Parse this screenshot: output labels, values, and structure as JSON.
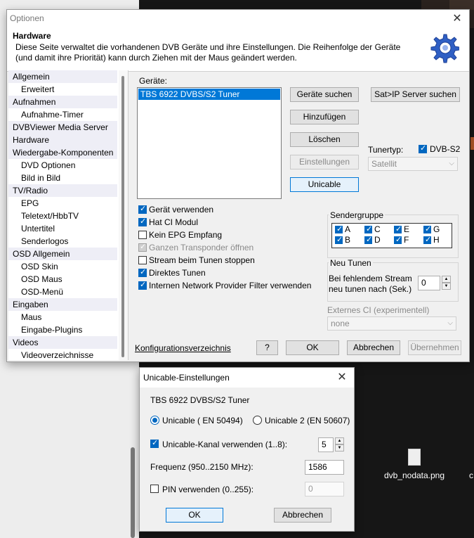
{
  "main_dialog": {
    "title": "Optionen",
    "header_title": "Hardware",
    "header_desc": "Diese Seite verwaltet die vorhandenen DVB Geräte und ihre Einstellungen. Die Reihenfolge der Geräte (und damit ihre Priorität) kann durch Ziehen mit der Maus geändert werden.",
    "gear_icon": "gear-icon"
  },
  "tree": {
    "items": [
      {
        "label": "Allgemein",
        "cat": true
      },
      {
        "label": "Erweitert",
        "cat": false
      },
      {
        "label": "Aufnahmen",
        "cat": true
      },
      {
        "label": "Aufnahme-Timer",
        "cat": false
      },
      {
        "label": "DVBViewer Media Server",
        "cat": true
      },
      {
        "label": "Hardware",
        "cat": true
      },
      {
        "label": "Wiedergabe-Komponenten",
        "cat": true
      },
      {
        "label": "DVD Optionen",
        "cat": false
      },
      {
        "label": "Bild in Bild",
        "cat": false
      },
      {
        "label": "TV/Radio",
        "cat": true
      },
      {
        "label": "EPG",
        "cat": false
      },
      {
        "label": "Teletext/HbbTV",
        "cat": false
      },
      {
        "label": "Untertitel",
        "cat": false
      },
      {
        "label": "Senderlogos",
        "cat": false
      },
      {
        "label": "OSD Allgemein",
        "cat": true
      },
      {
        "label": "OSD Skin",
        "cat": false
      },
      {
        "label": "OSD Maus",
        "cat": false
      },
      {
        "label": "OSD-Menü",
        "cat": false
      },
      {
        "label": "Eingaben",
        "cat": true
      },
      {
        "label": "Maus",
        "cat": false
      },
      {
        "label": "Eingabe-Plugins",
        "cat": false
      },
      {
        "label": "Videos",
        "cat": true
      },
      {
        "label": "Videoverzeichnisse",
        "cat": false
      }
    ]
  },
  "devices": {
    "label": "Geräte:",
    "list": [
      "TBS 6922 DVBS/S2 Tuner"
    ],
    "btn_search": "Geräte suchen",
    "btn_satip": "Sat>IP Server suchen",
    "btn_add": "Hinzufügen",
    "btn_delete": "Löschen",
    "btn_settings": "Einstellungen",
    "btn_unicable": "Unicable",
    "tunertype_label": "Tunertyp:",
    "dvbs2_label": "DVB-S2",
    "tunertype_value": "Satellit"
  },
  "options": [
    {
      "label": "Gerät verwenden",
      "state": "on"
    },
    {
      "label": "Hat CI Modul",
      "state": "on"
    },
    {
      "label": "Kein EPG Empfang",
      "state": "off"
    },
    {
      "label": "Ganzen Transponder öffnen",
      "state": "dis"
    },
    {
      "label": "Stream beim Tunen stoppen",
      "state": "off"
    },
    {
      "label": "Direktes Tunen",
      "state": "on"
    },
    {
      "label": "Internen Network Provider Filter verwenden",
      "state": "on"
    }
  ],
  "sendergruppe": {
    "title": "Sendergruppe",
    "groups": [
      "A",
      "C",
      "E",
      "G",
      "B",
      "D",
      "F",
      "H"
    ]
  },
  "neu_tunen": {
    "title": "Neu Tunen",
    "text1": "Bei fehlendem Stream",
    "text2": "neu tunen nach (Sek.)",
    "value": "0"
  },
  "externes_ci": {
    "title": "Externes CI (experimentell)",
    "value": "none"
  },
  "footer": {
    "config_link": "Konfigurationsverzeichnis",
    "help": "?",
    "ok": "OK",
    "cancel": "Abbrechen",
    "apply": "Übernehmen"
  },
  "unicable_dialog": {
    "title": "Unicable-Einstellungen",
    "device": "TBS 6922 DVBS/S2 Tuner",
    "radio1": "Unicable ( EN 50494)",
    "radio2": "Unicable 2 (EN 50607)",
    "channel_label": "Unicable-Kanal verwenden (1..8):",
    "channel_value": "5",
    "freq_label": "Frequenz (950..2150 MHz):",
    "freq_value": "1586",
    "pin_label": "PIN verwenden (0..255):",
    "pin_value": "0",
    "ok": "OK",
    "cancel": "Abbrechen"
  },
  "desktop": {
    "file_label": "dvb_nodata.png",
    "file_label2": "c"
  }
}
